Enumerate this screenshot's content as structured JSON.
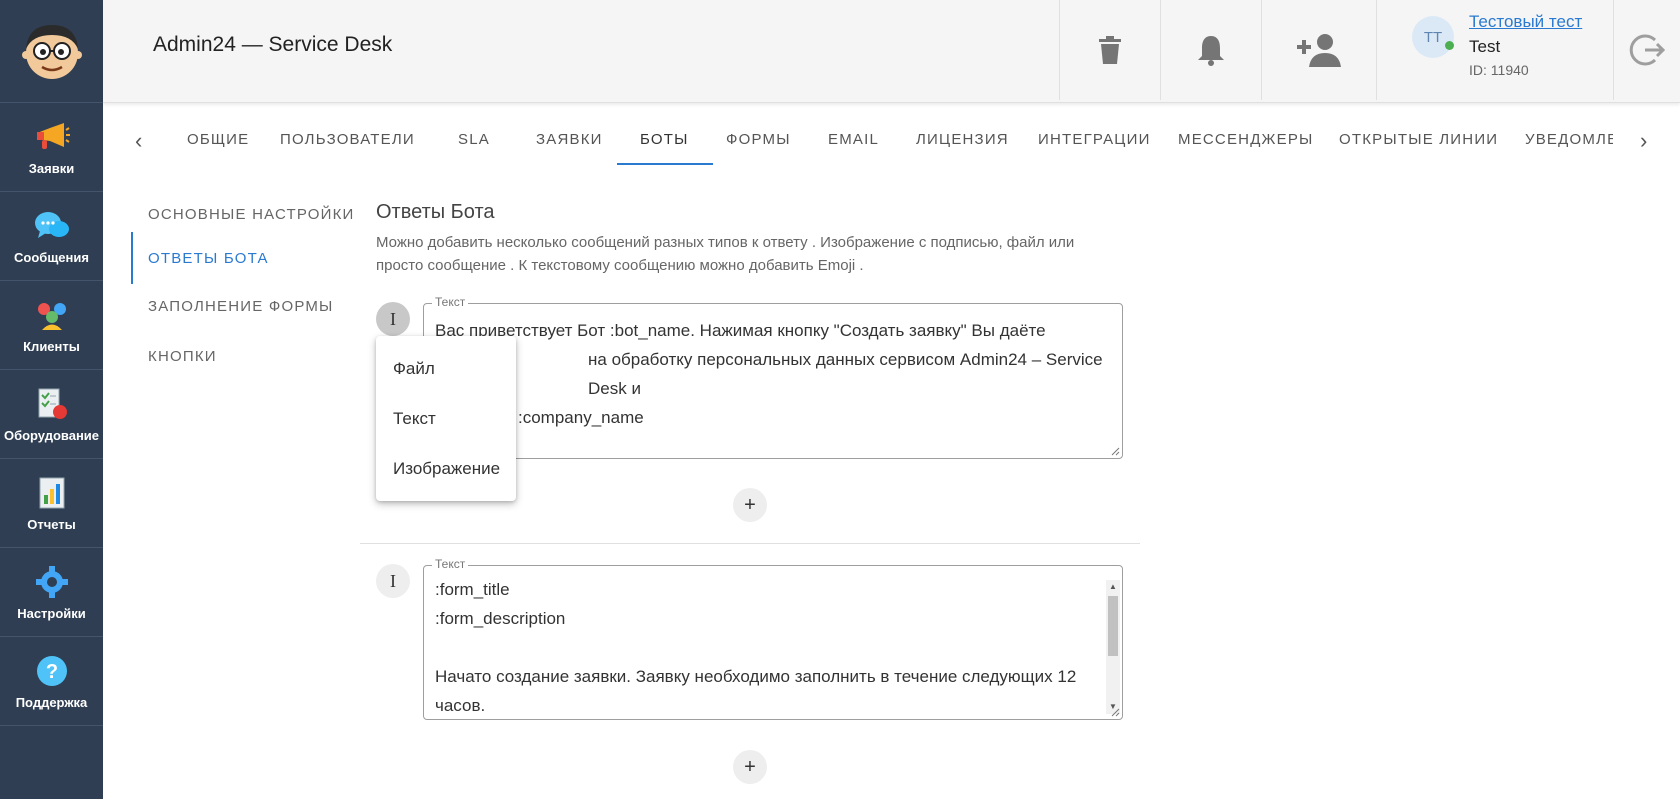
{
  "app": {
    "title": "Admin24 — Service Desk"
  },
  "sidebar": {
    "items": [
      {
        "label": "Заявки",
        "icon": "megaphone-icon"
      },
      {
        "label": "Сообщения",
        "icon": "chat-bubbles-icon"
      },
      {
        "label": "Клиенты",
        "icon": "people-icon"
      },
      {
        "label": "Оборудование",
        "icon": "equipment-checklist-icon"
      },
      {
        "label": "Отчеты",
        "icon": "report-chart-icon"
      },
      {
        "label": "Настройки",
        "icon": "gear-icon"
      },
      {
        "label": "Поддержка",
        "icon": "help-icon"
      }
    ]
  },
  "header": {
    "user": {
      "initials": "ТТ",
      "link": "Тестовый тест",
      "name": "Test",
      "id": "ID: 11940"
    }
  },
  "tabs": [
    "ОБЩИЕ",
    "ПОЛЬЗОВАТЕЛИ",
    "SLA",
    "ЗАЯВКИ",
    "БОТЫ",
    "ФОРМЫ",
    "EMAIL",
    "ЛИЦЕНЗИЯ",
    "ИНТЕГРАЦИИ",
    "МЕССЕНДЖЕРЫ",
    "ОТКРЫТЫЕ ЛИНИИ",
    "УВЕДОМЛЕ"
  ],
  "active_tab": "БОТЫ",
  "subnav": [
    "ОСНОВНЫЕ НАСТРОЙКИ",
    "ОТВЕТЫ БОТА",
    "ЗАПОЛНЕНИЕ ФОРМЫ",
    "КНОПКИ"
  ],
  "active_subnav": "ОТВЕТЫ БОТА",
  "section": {
    "title": "Ответы Бота",
    "description": "Можно добавить несколько сообщений разных типов к ответу . Изображение с подписью, файл или просто сообщение . К текстовому сообщению можно добавить Emoji ."
  },
  "messages": [
    {
      "type_glyph": "I",
      "label": "Текст",
      "text_lines": [
        "Вас приветствует Бот :bot_name. Нажимая кнопку \"Создать заявку\" Вы даёте",
        "на обработку персональных данных сервисом Admin24 – Service Desk и",
        ":company_name"
      ]
    },
    {
      "type_glyph": "I",
      "label": "Текст",
      "text_lines": [
        ":form_title",
        ":form_description",
        "",
        "Начато создание заявки. Заявку необходимо заполнить в течение следующих 12",
        "часов."
      ]
    }
  ],
  "add_button": "+",
  "type_menu": [
    "Файл",
    "Текст",
    "Изображение"
  ],
  "colors": {
    "sidebar": "#2f3e52",
    "accent": "#2a7ad0",
    "online": "#4caf50"
  }
}
